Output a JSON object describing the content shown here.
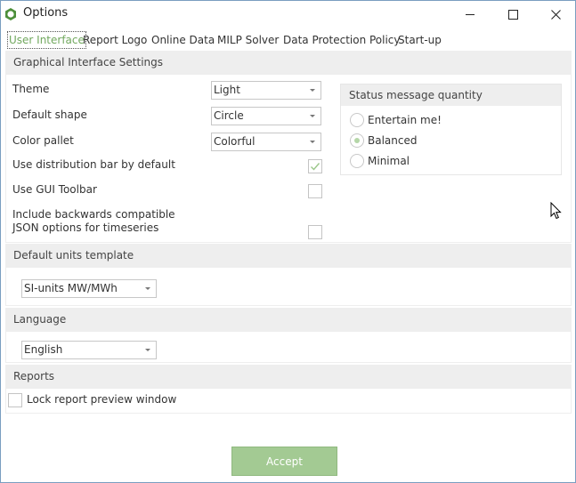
{
  "window": {
    "title": "Options"
  },
  "tabs": [
    {
      "label": "User Interface"
    },
    {
      "label": "Report Logo"
    },
    {
      "label": "Online Data"
    },
    {
      "label": "MILP Solver"
    },
    {
      "label": "Data Protection Policy"
    },
    {
      "label": "Start-up"
    }
  ],
  "graphical": {
    "header": "Graphical Interface Settings",
    "theme_label": "Theme",
    "theme_value": "Light",
    "shape_label": "Default shape",
    "shape_value": "Circle",
    "color_label": "Color pallet",
    "color_value": "Colorful",
    "distribution_label": "Use distribution bar by default",
    "distribution_checked": true,
    "toolbar_label": "Use GUI Toolbar",
    "toolbar_checked": false,
    "json_label_line1": "Include backwards compatible",
    "json_label_line2": "JSON options for timeseries",
    "json_checked": false
  },
  "status_group": {
    "header": "Status message quantity",
    "options": [
      {
        "label": "Entertain me!",
        "checked": false
      },
      {
        "label": "Balanced",
        "checked": true
      },
      {
        "label": "Minimal",
        "checked": false
      }
    ]
  },
  "units": {
    "header": "Default units template",
    "value": "SI-units MW/MWh"
  },
  "language": {
    "header": "Language",
    "value": "English"
  },
  "reports": {
    "header": "Reports",
    "lock_label": "Lock report preview window",
    "lock_checked": false
  },
  "footer": {
    "accept_label": "Accept"
  },
  "colors": {
    "accent": "#71a85e",
    "accept_bg": "#a3ca93",
    "section_bg": "#eeeeee"
  }
}
